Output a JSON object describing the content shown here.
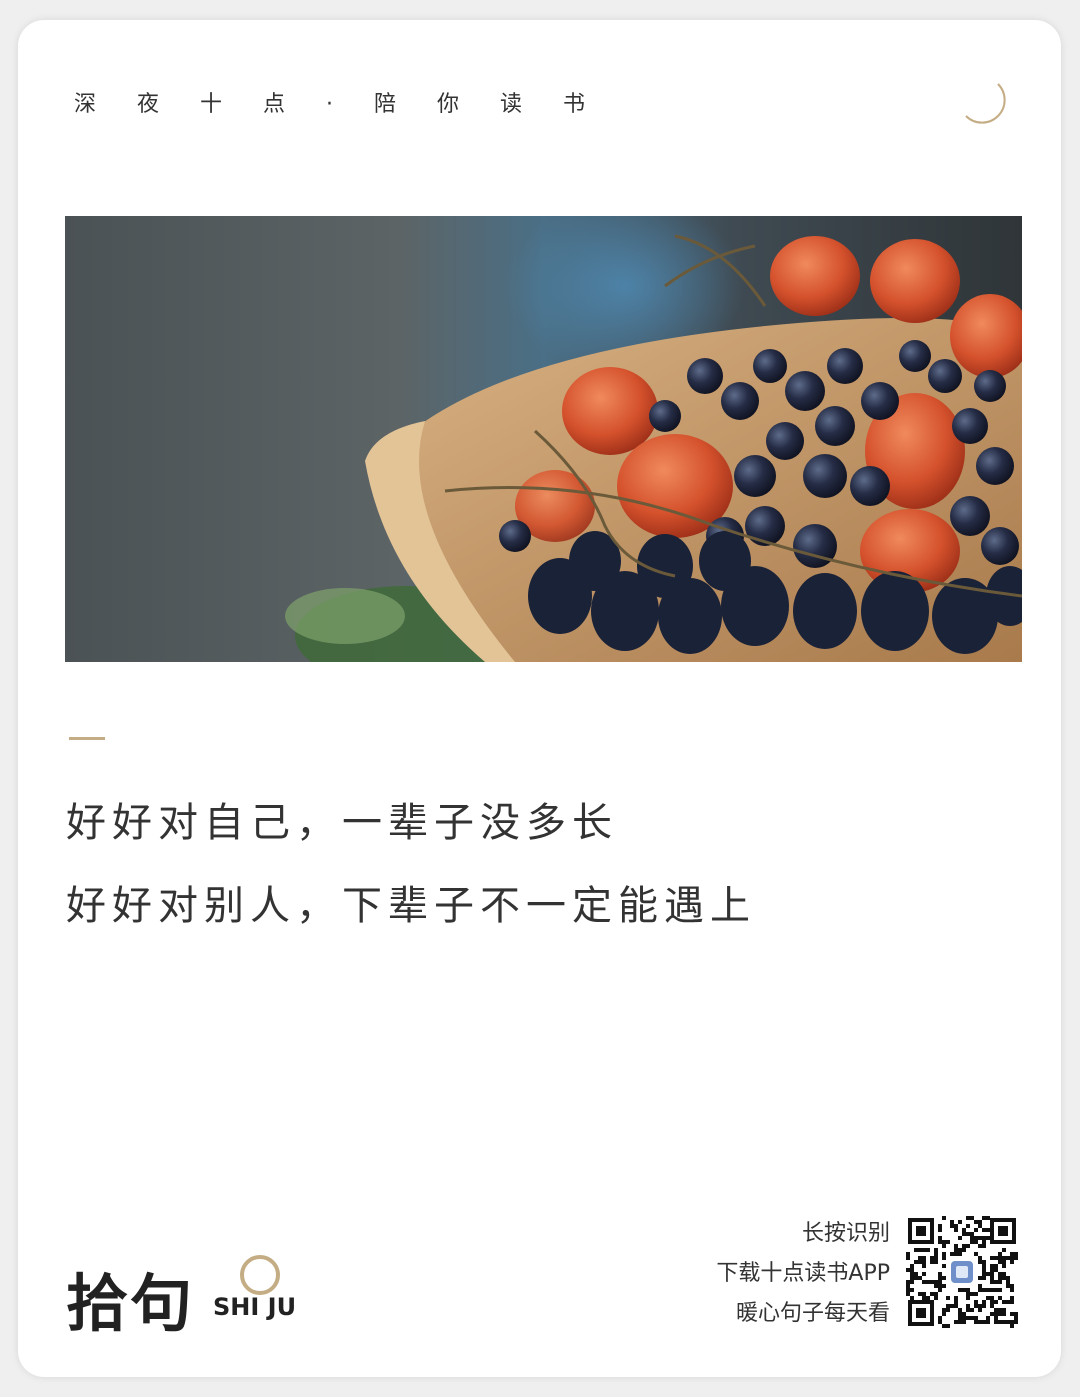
{
  "header": {
    "tagline": "深夜十点·陪你读书",
    "moon_icon": "crescent-moon-icon"
  },
  "image": {
    "subject": "fruit-bowl-photo"
  },
  "quote": {
    "line1": "好好对自己，一辈子没多长",
    "line2": "好好对别人，下辈子不一定能遇上"
  },
  "logo": {
    "chinese": "拾句",
    "english": "SHI JU"
  },
  "promo": {
    "line1": "长按识别",
    "line2": "下载十点读书APP",
    "line3": "暖心句子每天看",
    "qr_icon": "qr-code-icon"
  },
  "colors": {
    "accent": "#c4ad84",
    "text": "#333333",
    "background": "#ffffff"
  }
}
